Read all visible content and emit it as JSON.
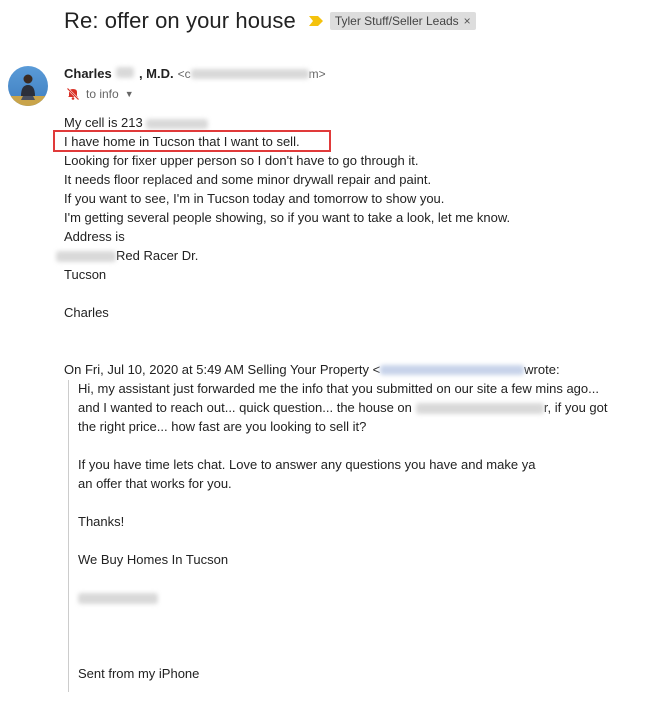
{
  "email": {
    "subject": "Re: offer on your house",
    "label": "Tyler Stuff/Seller Leads",
    "label_remove": "×",
    "sender": {
      "name_prefix": "Charles",
      "name_suffix": ", M.D.",
      "email_open": "<c",
      "email_close": "m>"
    },
    "recipient": "to info",
    "recipient_dropdown": "▼",
    "body": {
      "cell_prefix": "My cell is 213",
      "line_highlighted": "I have home in Tucson that I want to sell.",
      "line_3": "Looking for fixer upper person so I don't have to go through it.",
      "line_4": "It needs floor replaced and some minor drywall repair and paint.",
      "line_5": "If you want to see, I'm in Tucson today and tomorrow to show you.",
      "line_6": "I'm getting several people showing, so if you want to take a look, let me know.",
      "line_7": "Address is",
      "address_suffix": "Red Racer Dr.",
      "city": "Tucson",
      "signature": "Charles"
    },
    "quote": {
      "header_prefix": "On Fri, Jul 10, 2020 at 5:49 AM Selling Your Property <",
      "header_suffix": " wrote:",
      "line_1": "Hi, my assistant just forwarded me the info that you submitted on our site a few mins ago...",
      "line_2_prefix": "and I wanted to reach out... quick question... the house on",
      "line_2_suffix": "r, if you got",
      "line_3": "the right price... how fast are you looking to sell it?",
      "line_4": "If you have time lets chat.  Love to answer any questions you have and make ya",
      "line_5": "an offer that works for you.",
      "line_6": "Thanks!",
      "line_7": "We Buy Homes In Tucson",
      "line_8": "Sent from my iPhone"
    }
  },
  "colors": {
    "highlight_border": "#e03a3a",
    "label_chip_bg": "#dddddd",
    "important_marker": "#f4c20d"
  }
}
